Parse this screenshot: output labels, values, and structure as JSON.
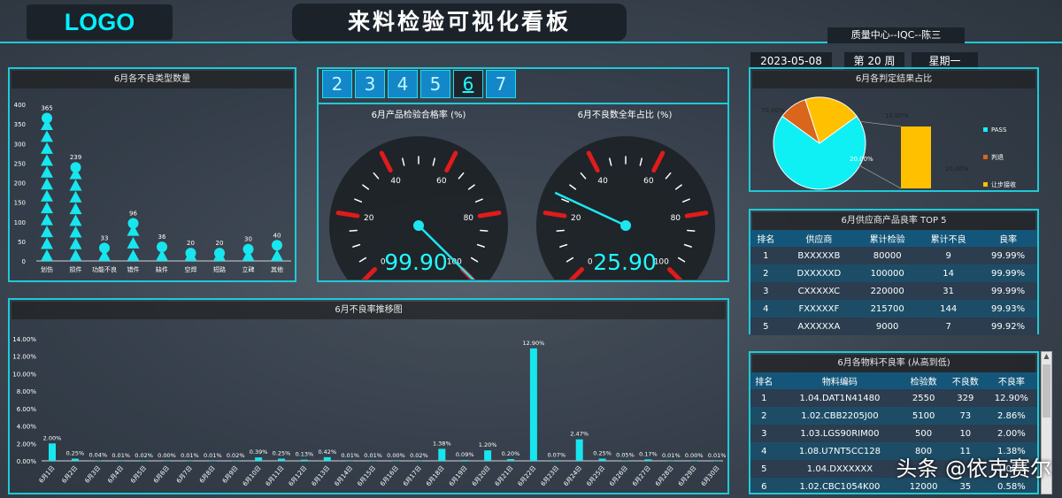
{
  "header": {
    "logo": "LOGO",
    "title": "来料检验可视化看板",
    "subtitle": "质量中心--IQC--陈三",
    "date": "2023-05-08",
    "week": "第 20 周",
    "weekday": "星期一"
  },
  "month_buttons": [
    "2",
    "3",
    "4",
    "5",
    "6",
    "7"
  ],
  "selected_month": "6",
  "defect_type_chart": {
    "title": "6月各不良类型数量",
    "chart_data": {
      "type": "bar",
      "categories": [
        "划伤",
        "损件",
        "功能不良",
        "错件",
        "缺件",
        "空焊",
        "短路",
        "立碑",
        "其他"
      ],
      "values": [
        365,
        239,
        33,
        96,
        36,
        20,
        20,
        30,
        40
      ],
      "ylim": [
        0,
        400
      ],
      "yticks": [
        0,
        50,
        100,
        150,
        200,
        250,
        300,
        350,
        400
      ]
    }
  },
  "gauge_pass": {
    "title": "6月产品检验合格率 (%)",
    "value_text": "99.90",
    "value": 99.9,
    "ticks": [
      "0",
      "20",
      "40",
      "60",
      "80",
      "100"
    ]
  },
  "gauge_defect": {
    "title": "6月不良数全年占比 (%)",
    "value_text": "25.90",
    "value": 25.9,
    "ticks": [
      "0",
      "20",
      "40",
      "60",
      "80",
      "100"
    ]
  },
  "trend_chart": {
    "title": "6月不良率推移图",
    "chart_data": {
      "type": "bar",
      "categories": [
        "6月1日",
        "6月2日",
        "6月3日",
        "6月4日",
        "6月5日",
        "6月6日",
        "6月7日",
        "6月8日",
        "6月9日",
        "6月10日",
        "6月11日",
        "6月12日",
        "6月13日",
        "6月14日",
        "6月15日",
        "6月16日",
        "6月17日",
        "6月18日",
        "6月19日",
        "6月20日",
        "6月21日",
        "6月22日",
        "6月23日",
        "6月24日",
        "6月25日",
        "6月26日",
        "6月27日",
        "6月28日",
        "6月29日",
        "6月30日"
      ],
      "values": [
        2.0,
        0.25,
        0.04,
        0.01,
        0.02,
        0.0,
        0.01,
        0.01,
        0.02,
        0.39,
        0.25,
        0.13,
        0.42,
        0.01,
        0.01,
        0.0,
        0.02,
        1.38,
        0.09,
        1.2,
        0.2,
        12.9,
        0.07,
        2.47,
        0.25,
        0.05,
        0.17,
        0.01,
        0.0,
        0.01
      ],
      "labels": [
        "2.00%",
        "0.25%",
        "0.04%",
        "0.01%",
        "0.02%",
        "0.00%",
        "0.01%",
        "0.01%",
        "0.02%",
        "0.39%",
        "0.25%",
        "0.13%",
        "0.42%",
        "0.01%",
        "0.01%",
        "0.00%",
        "0.02%",
        "1.38%",
        "0.09%",
        "1.20%",
        "0.20%",
        "12.90%",
        "0.07%",
        "2.47%",
        "0.25%",
        "0.05%",
        "0.17%",
        "0.01%",
        "0.00%",
        "0.01%"
      ],
      "ylim": [
        0,
        14
      ],
      "yticks": [
        "0.00%",
        "2.00%",
        "4.00%",
        "6.00%",
        "8.00%",
        "10.00%",
        "12.00%",
        "14.00%"
      ]
    }
  },
  "judgement_chart": {
    "title": "6月各判定结果占比",
    "chart_data": {
      "type": "pie",
      "categories": [
        "PASS",
        "判退",
        "让步接收"
      ],
      "values": [
        70,
        10,
        20
      ],
      "labels": [
        "70.00%",
        "10.00%",
        "20.00%"
      ],
      "colors": [
        "#0ff0f5",
        "#d9661a",
        "#ffc000"
      ],
      "bar_label": "20.00%"
    }
  },
  "supplier_table": {
    "title": "6月供应商产品良率 TOP 5",
    "headers": [
      "排名",
      "供应商",
      "累计检验",
      "累计不良",
      "良率"
    ],
    "rows": [
      [
        "1",
        "BXXXXXB",
        "80000",
        "9",
        "99.99%"
      ],
      [
        "2",
        "DXXXXXD",
        "100000",
        "14",
        "99.99%"
      ],
      [
        "3",
        "CXXXXXC",
        "220000",
        "31",
        "99.99%"
      ],
      [
        "4",
        "FXXXXXF",
        "215700",
        "144",
        "99.93%"
      ],
      [
        "5",
        "AXXXXXA",
        "9000",
        "7",
        "99.92%"
      ]
    ]
  },
  "material_table": {
    "title": "6月各物料不良率 (从高到低)",
    "headers": [
      "排名",
      "物料编码",
      "检验数",
      "不良数",
      "不良率"
    ],
    "rows": [
      [
        "1",
        "1.04.DAT1N41480",
        "2550",
        "329",
        "12.90%"
      ],
      [
        "2",
        "1.02.CBB2205J00",
        "5100",
        "73",
        "2.86%"
      ],
      [
        "3",
        "1.03.LGS90RIM00",
        "500",
        "10",
        "2.00%"
      ],
      [
        "4",
        "1.08.U7NT5CC128",
        "800",
        "11",
        "1.38%"
      ],
      [
        "5",
        "1.04.DXXXXXX",
        "",
        "",
        "1.00%"
      ],
      [
        "6",
        "1.02.CBC1054K00",
        "12000",
        "35",
        "0.58%"
      ]
    ]
  },
  "watermark": "头条 @依克赛尔"
}
